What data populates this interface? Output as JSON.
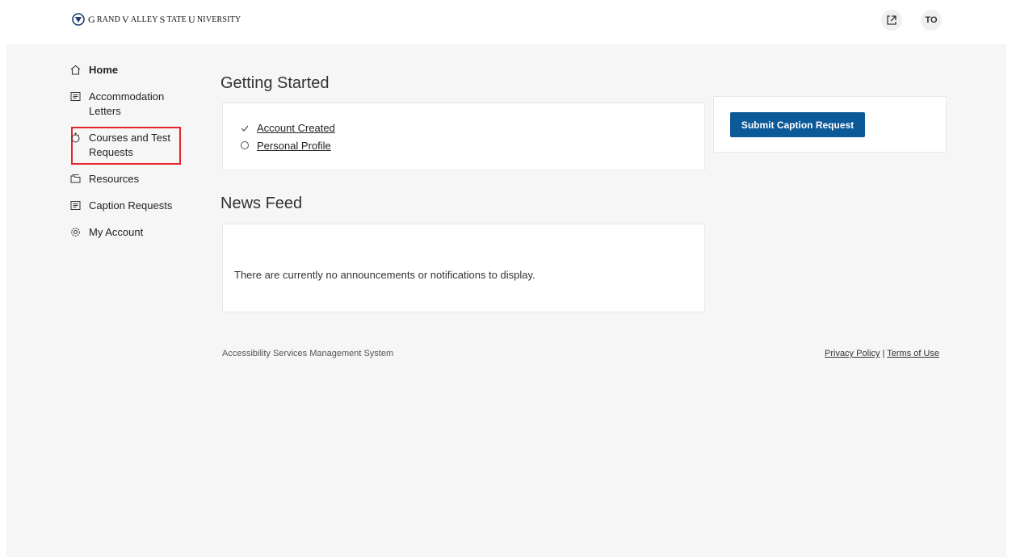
{
  "header": {
    "logo_text_g": "G",
    "logo_text_rand": "RAND",
    "logo_text_v": "V",
    "logo_text_alley": "ALLEY",
    "logo_text_s": "S",
    "logo_text_tate": "TATE",
    "logo_text_u": "U",
    "logo_text_niversity": "NIVERSITY",
    "share_icon": "external-link-icon",
    "avatar_initials": "TO"
  },
  "sidebar": {
    "items": [
      {
        "label": "Home",
        "icon": "home-icon"
      },
      {
        "label": "Accommodation Letters",
        "icon": "letter-icon"
      },
      {
        "label": "Courses and Test Requests",
        "icon": "timer-icon"
      },
      {
        "label": "Resources",
        "icon": "folder-icon"
      },
      {
        "label": "Caption Requests",
        "icon": "caption-icon"
      },
      {
        "label": "My Account",
        "icon": "gear-icon"
      }
    ]
  },
  "getting_started": {
    "title": "Getting Started",
    "items": [
      {
        "label": "Account Created",
        "status": "complete"
      },
      {
        "label": "Personal Profile",
        "status": "incomplete"
      }
    ]
  },
  "caption_card": {
    "button_label": "Submit Caption Request"
  },
  "news_feed": {
    "title": "News Feed",
    "message": "There are currently no announcements or notifications to display."
  },
  "footer": {
    "system_name": "Accessibility Services Management System",
    "privacy_label": "Privacy Policy",
    "separator": "|",
    "terms_label": "Terms of Use"
  },
  "colors": {
    "primary": "#0c5998",
    "highlight": "#e5242b",
    "background": "#f6f6f6"
  }
}
